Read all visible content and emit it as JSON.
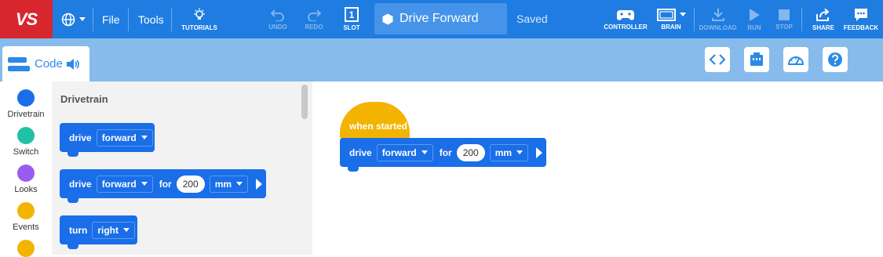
{
  "topbar": {
    "logo": "VS",
    "file": "File",
    "tools": "Tools",
    "tutorials": "TUTORIALS",
    "undo": "UNDO",
    "redo": "REDO",
    "slot_number": "1",
    "slot": "SLOT",
    "project_title": "Drive Forward",
    "status": "Saved",
    "controller": "CONTROLLER",
    "brain": "BRAIN",
    "download": "DOWNLOAD",
    "run": "RUN",
    "stop": "STOP",
    "share": "SHARE",
    "feedback": "FEEDBACK"
  },
  "code_tab": {
    "label": "Code"
  },
  "categories": [
    {
      "label": "Drivetrain",
      "color": "#1a6ee8"
    },
    {
      "label": "Switch",
      "color": "#20c2a3"
    },
    {
      "label": "Looks",
      "color": "#9a5cf0"
    },
    {
      "label": "Events",
      "color": "#f2b400"
    },
    {
      "label": "",
      "color": "#f2b400"
    }
  ],
  "palette": {
    "title": "Drivetrain",
    "blocks": [
      {
        "text": "drive",
        "dropdown": "forward"
      },
      {
        "text": "drive",
        "dropdown": "forward",
        "kw": "for",
        "value": "200",
        "unit": "mm"
      },
      {
        "text": "turn",
        "dropdown": "right"
      }
    ]
  },
  "workspace": {
    "hat": "when started",
    "block": {
      "text": "drive",
      "dropdown": "forward",
      "kw": "for",
      "value": "200",
      "unit": "mm"
    }
  },
  "colors": {
    "topbar": "#1f7ce0",
    "logo_bg": "#d8262e",
    "subbar": "#86bbec",
    "drivetrain": "#1a6ee8",
    "events": "#f2b400"
  }
}
